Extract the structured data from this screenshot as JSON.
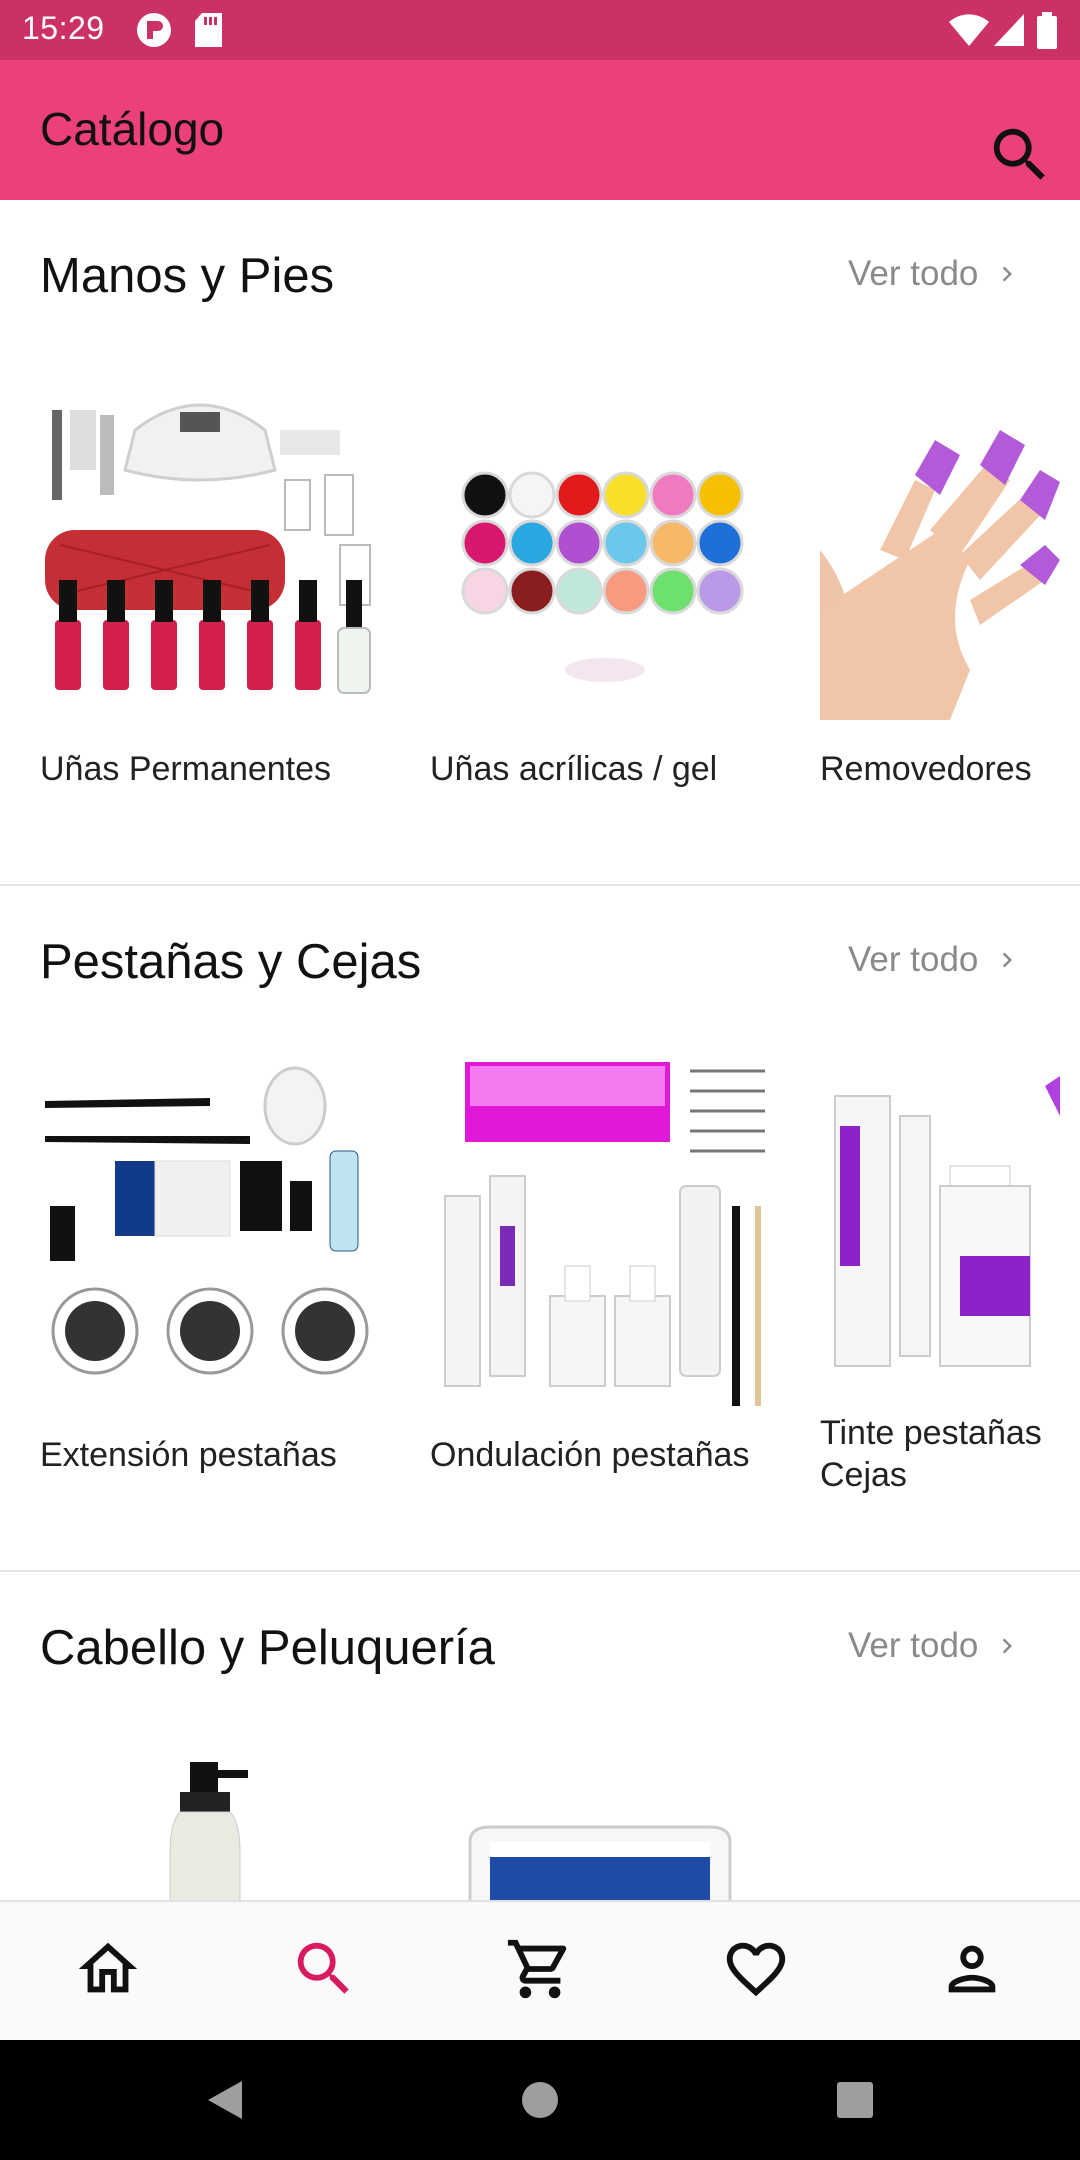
{
  "status_bar": {
    "time": "15:29"
  },
  "app_bar": {
    "title": "Catálogo"
  },
  "sections": [
    {
      "title": "Manos y Pies",
      "see_all": "Ver todo",
      "items": [
        {
          "label": "Uñas Permanentes"
        },
        {
          "label": "Uñas acrílicas / gel"
        },
        {
          "label": "Removedores"
        }
      ]
    },
    {
      "title": "Pestañas y Cejas",
      "see_all": "Ver todo",
      "items": [
        {
          "label": "Extensión pestañas"
        },
        {
          "label": "Ondulación pestañas"
        },
        {
          "label": "Tinte pestañas Cejas"
        }
      ]
    },
    {
      "title": "Cabello y Peluquería",
      "see_all": "Ver todo",
      "items": [
        {
          "label": ""
        },
        {
          "label": ""
        }
      ]
    }
  ],
  "bottom_nav": [
    {
      "icon": "home-icon"
    },
    {
      "icon": "search-icon",
      "active": true
    },
    {
      "icon": "cart-icon"
    },
    {
      "icon": "heart-icon"
    },
    {
      "icon": "profile-icon"
    }
  ],
  "colors": {
    "status_bar": "#cc3166",
    "app_bar": "#ec407a",
    "accent": "#d81b60"
  }
}
